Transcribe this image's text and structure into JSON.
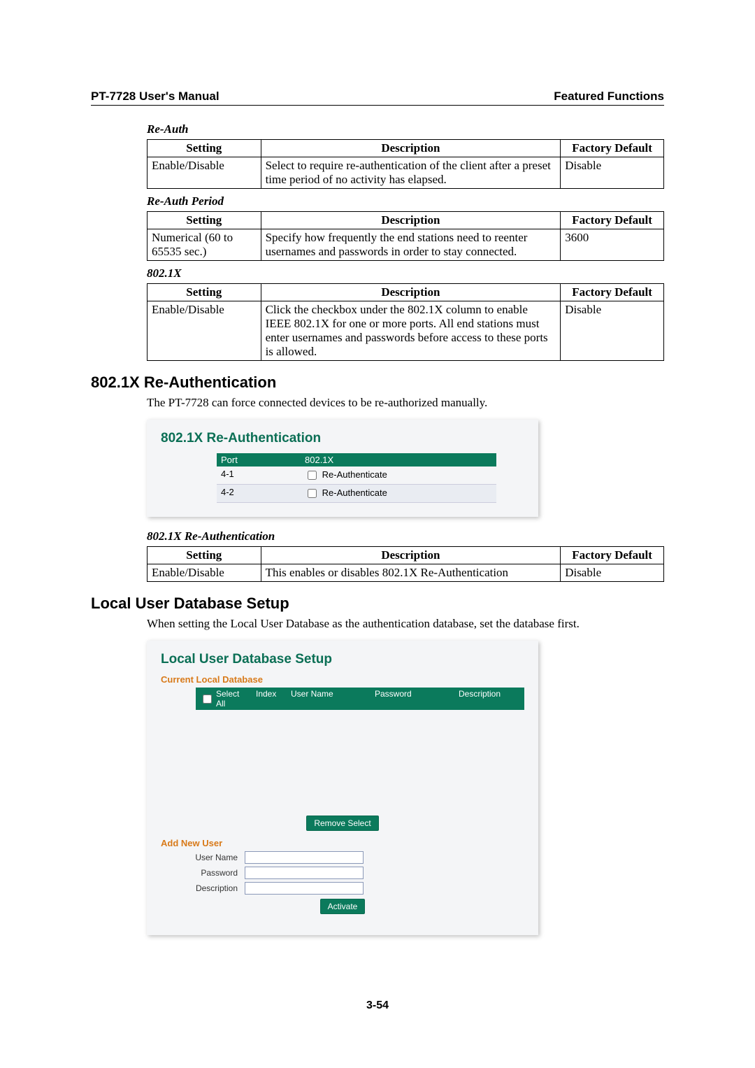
{
  "header": {
    "left": "PT-7728 User's Manual",
    "right": "Featured Functions"
  },
  "tableHeaders": {
    "setting": "Setting",
    "description": "Description",
    "default": "Factory Default"
  },
  "reauth": {
    "title": "Re-Auth",
    "setting": "Enable/Disable",
    "desc": "Select to require re-authentication of the client after a preset time period of no activity has elapsed.",
    "def": "Disable"
  },
  "reauthPeriod": {
    "title": "Re-Auth Period",
    "setting": "Numerical (60 to 65535 sec.)",
    "desc": "Specify how frequently the end stations need to reenter usernames and passwords in order to stay connected.",
    "def": "3600"
  },
  "x8021": {
    "title": "802.1X",
    "setting": "Enable/Disable",
    "desc": "Click the checkbox under the 802.1X column to enable IEEE 802.1X for one or more ports. All end stations must enter usernames and passwords before access to these ports is allowed.",
    "def": "Disable"
  },
  "sectionReauth": {
    "heading": "802.1X Re-Authentication",
    "intro": "The PT-7728 can force connected devices to be re-authorized manually."
  },
  "ssReauth": {
    "title": "802.1X Re-Authentication",
    "col1": "Port",
    "col2": "802.1X",
    "rows": [
      {
        "port": "4-1",
        "label": "Re-Authenticate"
      },
      {
        "port": "4-2",
        "label": "Re-Authenticate"
      }
    ]
  },
  "reauthTable": {
    "title": "802.1X Re-Authentication",
    "setting": "Enable/Disable",
    "desc": "This enables or disables 802.1X Re-Authentication",
    "def": "Disable"
  },
  "sectionLocal": {
    "heading": "Local User Database Setup",
    "intro": "When setting the Local User Database as the authentication database, set the database first."
  },
  "ssLocal": {
    "title": "Local User Database Setup",
    "subtitle": "Current Local Database",
    "cols": {
      "select": "Select All",
      "index": "Index",
      "user": "User Name",
      "pass": "Password",
      "desc": "Description"
    },
    "removeBtn": "Remove Select",
    "addTitle": "Add New User",
    "form": {
      "user": "User Name",
      "pass": "Password",
      "desc": "Description"
    },
    "activateBtn": "Activate"
  },
  "pageNum": "3-54"
}
